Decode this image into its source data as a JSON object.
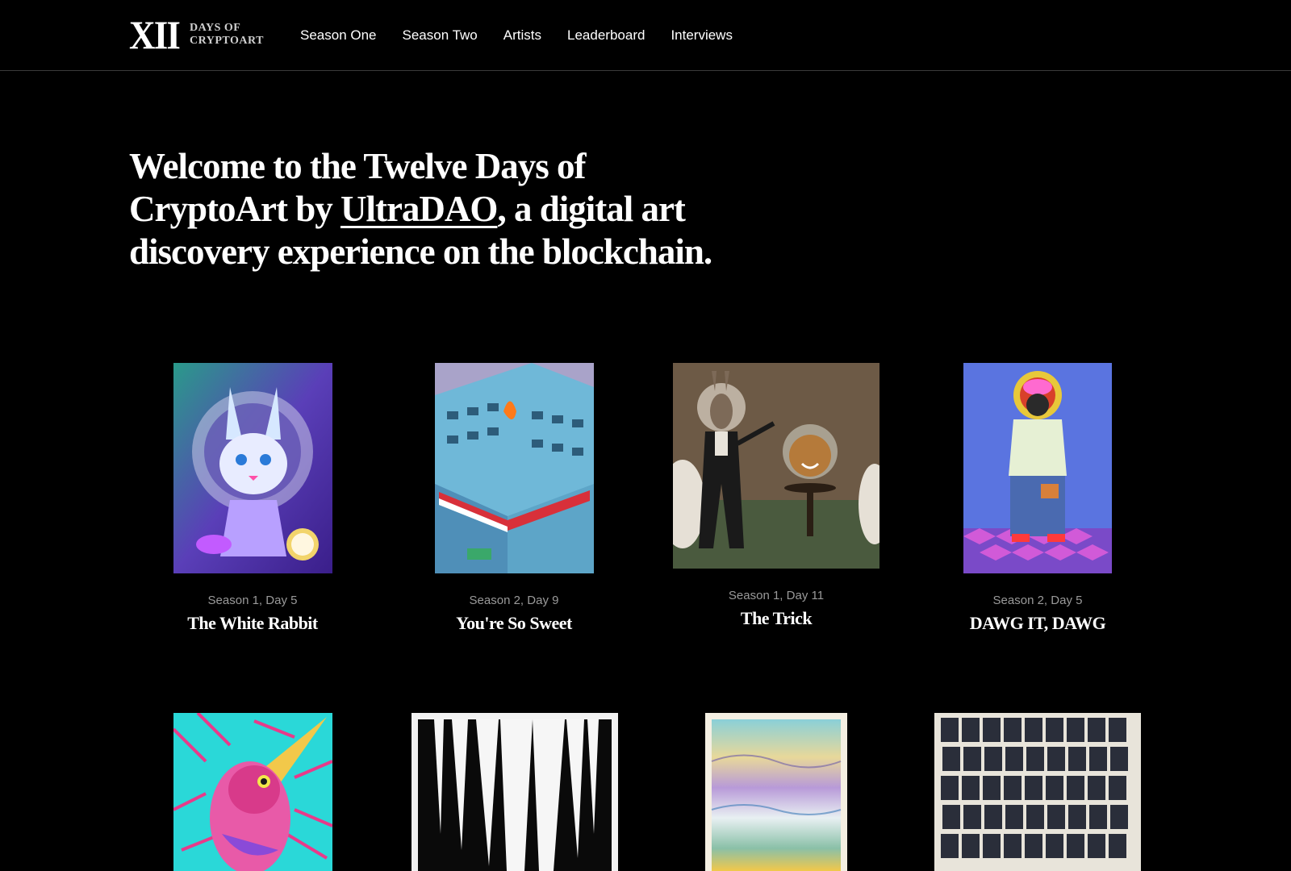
{
  "header": {
    "logo_mark": "XII",
    "logo_line1": "DAYS OF",
    "logo_line2": "CRYPTOART",
    "nav": [
      "Season One",
      "Season Two",
      "Artists",
      "Leaderboard",
      "Interviews"
    ]
  },
  "hero": {
    "text_before": "Welcome to the Twelve Days of CryptoArt by ",
    "link_text": "UltraDAO",
    "text_after": ", a digital art discovery experience on the blockchain."
  },
  "gallery": [
    {
      "meta": "Season 1, Day 5",
      "title": "The White Rabbit"
    },
    {
      "meta": "Season 2, Day 9",
      "title": "You're So Sweet"
    },
    {
      "meta": "Season 1, Day 11",
      "title": "The Trick"
    },
    {
      "meta": "Season 2, Day 5",
      "title": "DAWG IT, DAWG"
    }
  ],
  "colors": {
    "background": "#000000",
    "border": "#3a3a3a",
    "meta_text": "#9a9a9a"
  }
}
